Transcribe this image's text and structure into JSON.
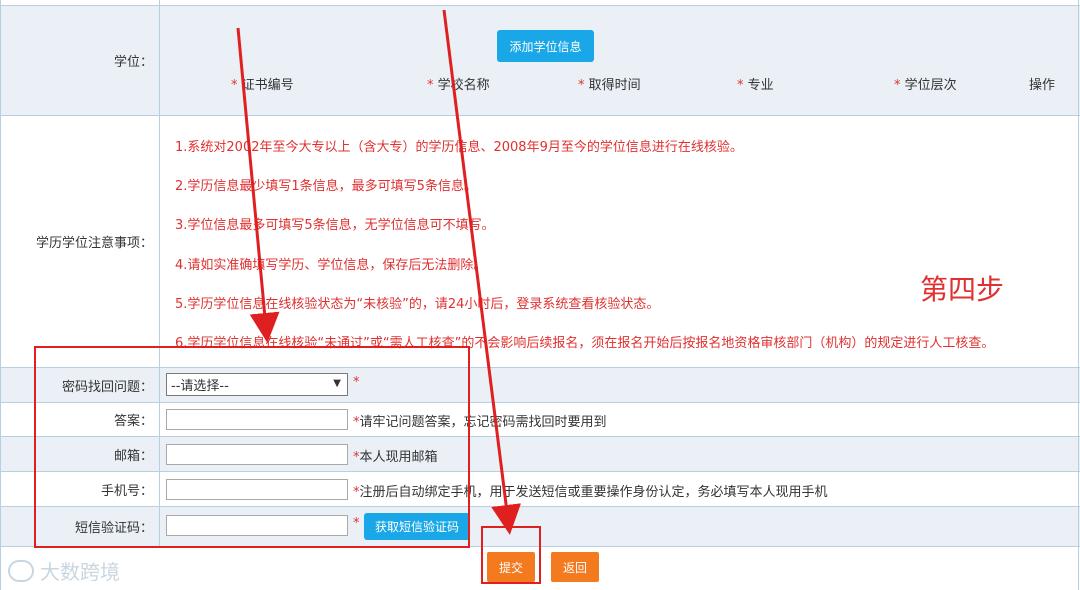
{
  "degree_row": {
    "label": "学位：",
    "add_button": "添加学位信息",
    "columns": [
      {
        "star": "*",
        "text": "证书编号"
      },
      {
        "star": "*",
        "text": "学校名称"
      },
      {
        "star": "*",
        "text": "取得时间"
      },
      {
        "star": "*",
        "text": "专业"
      },
      {
        "star": "*",
        "text": "学位层次"
      },
      {
        "star": "",
        "text": "操作"
      }
    ]
  },
  "notes_row": {
    "label": "学历学位注意事项：",
    "items": [
      "1.系统对2002年至今大专以上（含大专）的学历信息、2008年9月至今的学位信息进行在线核验。",
      "2.学历信息最少填写1条信息，最多可填写5条信息。",
      "3.学位信息最多可填写5条信息，无学位信息可不填写。",
      "4.请如实准确填写学历、学位信息，保存后无法删除。",
      "5.学历学位信息在线核验状态为“未核验”的，请24小时后，登录系统查看核验状态。",
      "6.学历学位信息在线核验“未通过”或“需人工核查”的不会影响后续报名，须在报名开始后按报名地资格审核部门（机构）的规定进行人工核查。"
    ]
  },
  "form": {
    "question_label": "密码找回问题：",
    "question_value": "--请选择--",
    "question_star": "*",
    "answer_label": "答案：",
    "answer_hint_star": "*",
    "answer_hint": "请牢记问题答案，忘记密码需找回时要用到",
    "email_label": "邮箱：",
    "email_hint_star": "*",
    "email_hint": "本人现用邮箱",
    "phone_label": "手机号：",
    "phone_hint_star": "*",
    "phone_hint": "注册后自动绑定手机，用于发送短信或重要操作身份认定，务必填写本人现用手机",
    "sms_label": "短信验证码：",
    "sms_star": "*",
    "sms_button": "获取短信验证码"
  },
  "actions": {
    "submit": "提交",
    "back": "返回"
  },
  "annotation": {
    "step_text": "第四步"
  },
  "watermark": {
    "text": "大数跨境"
  },
  "colors": {
    "blue_button": "#1aa7e8",
    "orange_button": "#f47a20",
    "notice_red": "#e03030",
    "row_grey": "#eaf0f5",
    "border": "#b8cfe0"
  }
}
